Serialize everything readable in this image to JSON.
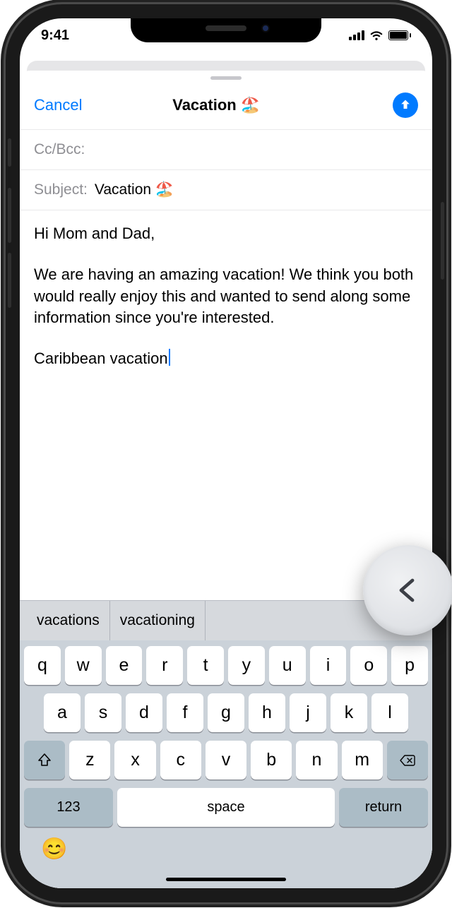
{
  "status": {
    "time": "9:41"
  },
  "nav": {
    "cancel": "Cancel",
    "title": "Vacation 🏖️"
  },
  "fields": {
    "ccbcc_label": "Cc/Bcc:",
    "subject_label": "Subject:",
    "subject_value": "Vacation 🏖️"
  },
  "body": {
    "greeting": "Hi Mom and Dad,",
    "para1": "We are having an amazing vacation! We think you both would really enjoy this and wanted to send along some information since you're interested.",
    "line2": "Caribbean vacation"
  },
  "predictions": [
    "vacations",
    "vacationing"
  ],
  "keyboard": {
    "row1": [
      "q",
      "w",
      "e",
      "r",
      "t",
      "y",
      "u",
      "i",
      "o",
      "p"
    ],
    "row2": [
      "a",
      "s",
      "d",
      "f",
      "g",
      "h",
      "j",
      "k",
      "l"
    ],
    "row3": [
      "z",
      "x",
      "c",
      "v",
      "b",
      "n",
      "m"
    ],
    "numbers": "123",
    "space": "space",
    "return": "return"
  }
}
